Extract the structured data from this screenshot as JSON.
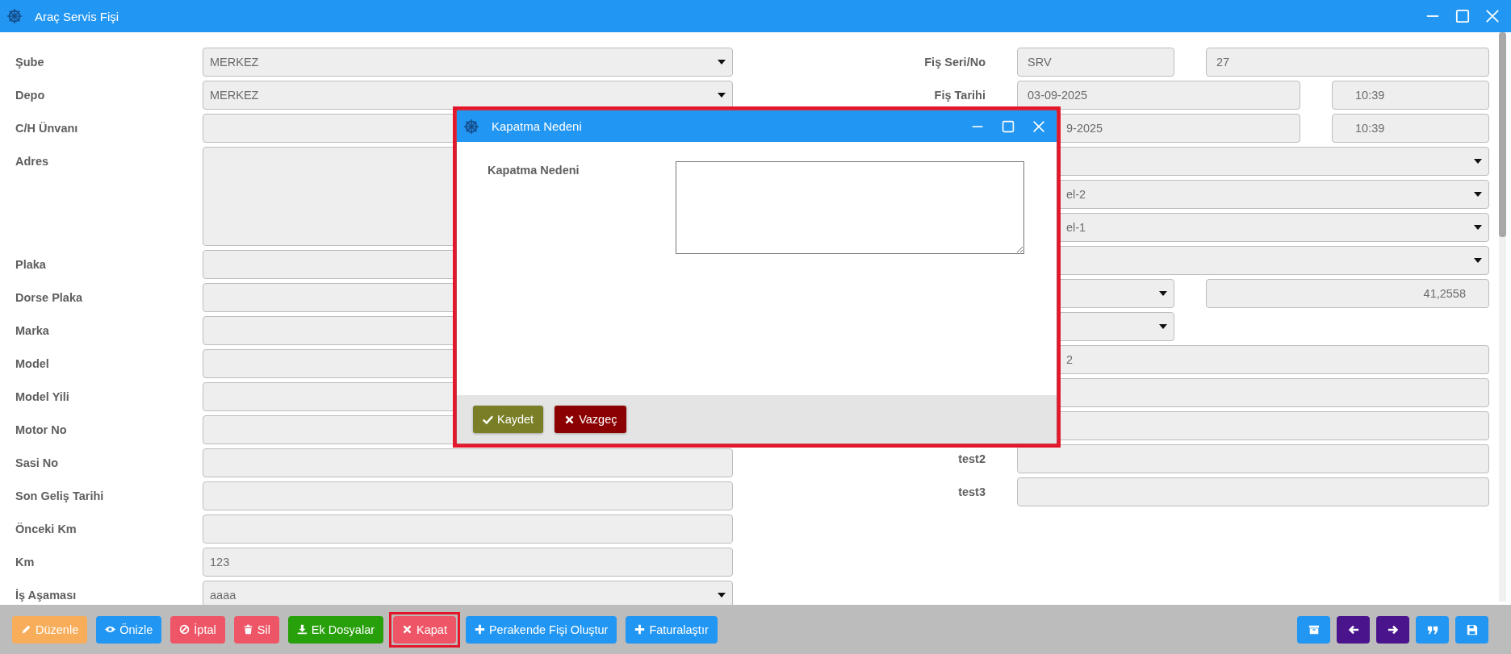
{
  "window": {
    "title": "Araç Servis Fişi"
  },
  "left_fields": [
    {
      "label": "Şube",
      "kind": "select",
      "value": "MERKEZ"
    },
    {
      "label": "Depo",
      "kind": "select",
      "value": "MERKEZ"
    },
    {
      "label": "C/H Ünvanı",
      "kind": "text"
    },
    {
      "label": "Adres",
      "kind": "textarea"
    },
    {
      "label": "Plaka",
      "kind": "text"
    },
    {
      "label": "Dorse Plaka",
      "kind": "text"
    },
    {
      "label": "Marka",
      "kind": "text"
    },
    {
      "label": "Model",
      "kind": "text"
    },
    {
      "label": "Model Yili",
      "kind": "text"
    },
    {
      "label": "Motor No",
      "kind": "text"
    },
    {
      "label": "Sasi No",
      "kind": "text"
    },
    {
      "label": "Son Geliş Tarihi",
      "kind": "text"
    },
    {
      "label": "Önceki Km",
      "kind": "text"
    },
    {
      "label": "Km",
      "kind": "text",
      "value": "123"
    },
    {
      "label": "İş Aşaması",
      "kind": "select",
      "value": "aaaa"
    }
  ],
  "right_fields": [
    {
      "label": "Fiş Seri/No",
      "kind": "pair",
      "inputs": [
        {
          "kind": "text",
          "value": "SRV"
        },
        {
          "kind": "text",
          "value": "27"
        }
      ]
    },
    {
      "label": "Fiş Tarihi",
      "kind": "datetime",
      "inputs": [
        {
          "kind": "text",
          "value": "03-09-2025"
        },
        {
          "kind": "text",
          "value": "10:39"
        }
      ]
    },
    {
      "kind": "datetime",
      "inputs": [
        {
          "kind": "text",
          "value": "9-2025"
        },
        {
          "kind": "text",
          "value": "10:39"
        }
      ]
    },
    {
      "kind": "single",
      "inputs": [
        {
          "kind": "select"
        }
      ]
    },
    {
      "kind": "single",
      "inputs": [
        {
          "kind": "select",
          "value": "el-2"
        }
      ]
    },
    {
      "kind": "single",
      "inputs": [
        {
          "kind": "select",
          "value": "el-1"
        }
      ]
    },
    {
      "kind": "single",
      "inputs": [
        {
          "kind": "select"
        }
      ]
    },
    {
      "kind": "pair",
      "inputs": [
        {
          "kind": "select"
        },
        {
          "kind": "number",
          "value": "41,2558"
        }
      ]
    },
    {
      "kind": "pair",
      "inputs": [
        {
          "kind": "select"
        }
      ]
    },
    {
      "kind": "single",
      "inputs": [
        {
          "kind": "text",
          "value": "2"
        }
      ]
    },
    {
      "kind": "single",
      "inputs": [
        {
          "kind": "text"
        }
      ]
    },
    {
      "kind": "single",
      "inputs": [
        {
          "kind": "text"
        }
      ]
    },
    {
      "label": "test2",
      "kind": "single",
      "inputs": [
        {
          "kind": "text"
        }
      ]
    },
    {
      "label": "test3",
      "kind": "single",
      "inputs": [
        {
          "kind": "text"
        }
      ]
    }
  ],
  "dialog": {
    "title": "Kapatma Nedeni",
    "highlighted": true,
    "field_label": "Kapatma Nedeni",
    "buttons": [
      {
        "label": "Kaydet",
        "kind": "save"
      },
      {
        "label": "Vazgeç",
        "kind": "cancel"
      }
    ]
  },
  "toolbar": {
    "buttons": [
      {
        "label": "Düzenle",
        "kind": "edit",
        "highlighted": false
      },
      {
        "label": "Önizle",
        "kind": "preview",
        "highlighted": false
      },
      {
        "label": "İptal",
        "kind": "void",
        "highlighted": false
      },
      {
        "label": "Sil",
        "kind": "delete",
        "highlighted": false
      },
      {
        "label": "Ek Dosyalar",
        "kind": "attachments",
        "highlighted": false
      },
      {
        "label": "Kapat",
        "kind": "close",
        "highlighted": true
      },
      {
        "label": "Perakende Fişi Oluştur",
        "kind": "create",
        "highlighted": false
      },
      {
        "label": "Faturalaştır",
        "kind": "invoice",
        "highlighted": false
      }
    ],
    "icon_buttons": [
      {
        "kind": "archive"
      },
      {
        "kind": "previous"
      },
      {
        "kind": "next"
      },
      {
        "kind": "quote"
      },
      {
        "kind": "save"
      }
    ]
  }
}
